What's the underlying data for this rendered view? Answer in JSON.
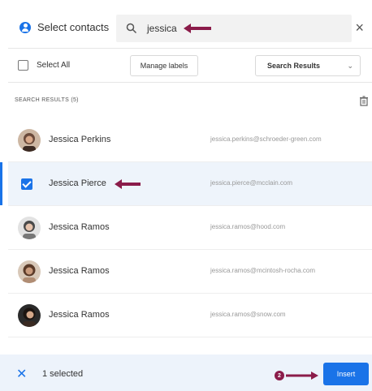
{
  "header": {
    "title": "Select contacts",
    "search_value": "jessica",
    "close_glyph": "×"
  },
  "toolbar": {
    "select_all_label": "Select All",
    "manage_labels": "Manage labels",
    "results_dropdown": "Search Results"
  },
  "section": {
    "heading": "SEARCH RESULTS (5)"
  },
  "contacts": [
    {
      "name": "Jessica Perkins",
      "email": "jessica.perkins@schroeder-green.com",
      "selected": false,
      "avatar_color": "#6b4a3a"
    },
    {
      "name": "Jessica Pierce",
      "email": "jessica.pierce@mcclain.com",
      "selected": true,
      "avatar_color": ""
    },
    {
      "name": "Jessica Ramos",
      "email": "jessica.ramos@hood.com",
      "selected": false,
      "avatar_color": "#8a8a8a"
    },
    {
      "name": "Jessica Ramos",
      "email": "jessica.ramos@mcintosh-rocha.com",
      "selected": false,
      "avatar_color": "#7a5a45"
    },
    {
      "name": "Jessica Ramos",
      "email": "jessica.ramos@snow.com",
      "selected": false,
      "avatar_color": "#3a2a22"
    }
  ],
  "footer": {
    "close_glyph": "✕",
    "selected_text": "1 selected",
    "step_number": "2",
    "insert_label": "Insert"
  },
  "colors": {
    "accent": "#1a73e8",
    "annotation": "#8b1c4a",
    "selected_row_bg": "#eef4fb"
  }
}
